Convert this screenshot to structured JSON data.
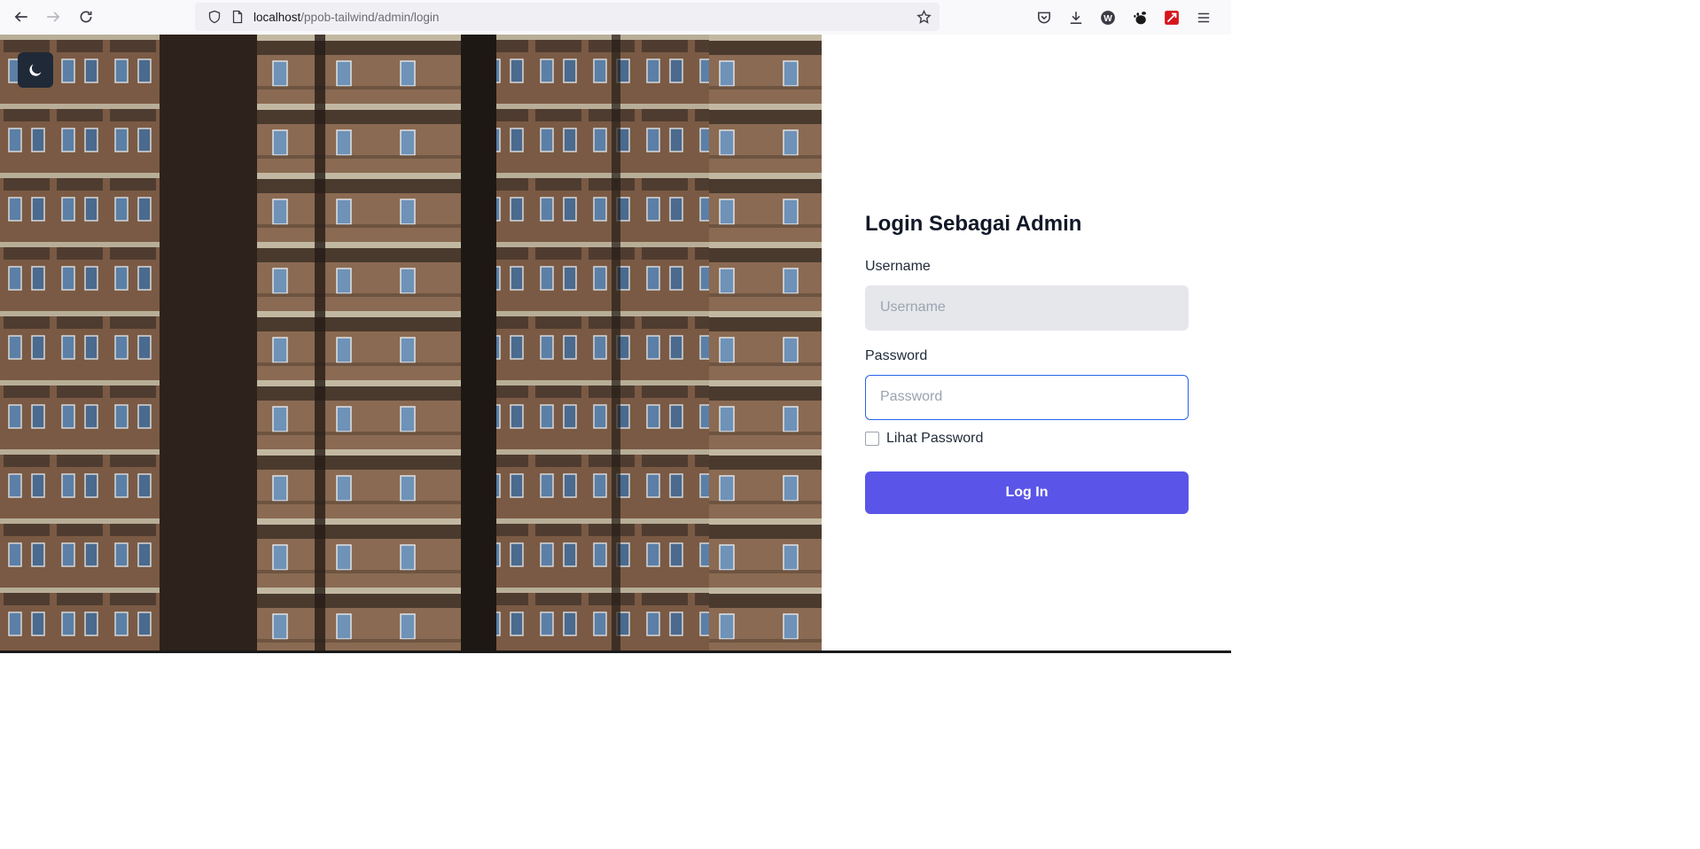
{
  "browser": {
    "url_host": "localhost",
    "url_path": "/ppob-tailwind/admin/login",
    "icons": {
      "back": "arrow-left-icon",
      "forward": "arrow-right-icon",
      "reload": "reload-icon",
      "shield": "shield-icon",
      "page": "page-icon",
      "bookmark": "star-icon",
      "pocket": "pocket-icon",
      "downloads": "download-icon",
      "extension_w": "w-extension-icon",
      "extension_gnome": "gnome-extension-icon",
      "extension_red": "red-extension-icon",
      "menu": "hamburger-menu-icon"
    }
  },
  "page": {
    "dark_mode_icon": "moon-icon",
    "login": {
      "title": "Login Sebagai Admin",
      "username_label": "Username",
      "username_placeholder": "Username",
      "password_label": "Password",
      "password_placeholder": "Password",
      "show_password_label": "Lihat Password",
      "submit_label": "Log In"
    },
    "colors": {
      "primary": "#5a55e8",
      "focus_border": "#2563eb",
      "toggle_bg": "#1f2937"
    }
  }
}
